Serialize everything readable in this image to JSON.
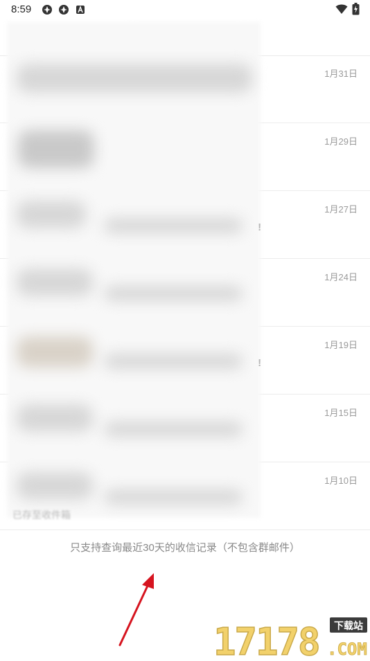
{
  "status_bar": {
    "time": "8:59",
    "left_icons": [
      "app-notification-icon",
      "app-notification-icon",
      "keyboard-a-icon"
    ],
    "right_icons": [
      "wifi-icon",
      "battery-charging-icon"
    ]
  },
  "inbox": {
    "rows": [
      {
        "date": "1月31日",
        "trail": ""
      },
      {
        "date": "1月29日",
        "trail": ""
      },
      {
        "date": "1月27日",
        "trail": "!"
      },
      {
        "date": "1月24日",
        "trail": ""
      },
      {
        "date": "1月19日",
        "trail": "!"
      },
      {
        "date": "1月15日",
        "trail": ""
      },
      {
        "date": "1月10日",
        "trail": ""
      }
    ],
    "partial_label": "已存至收件箱"
  },
  "footer": {
    "note": "只支持查询最近30天的收信记录（不包含群邮件）"
  },
  "watermark": {
    "number": "17178",
    "badge": "下载站",
    "domain": ".COM"
  },
  "colors": {
    "annotation_arrow": "#d6141f",
    "watermark_gold": "#f2d16b",
    "watermark_badge": "#3b3b3b"
  }
}
